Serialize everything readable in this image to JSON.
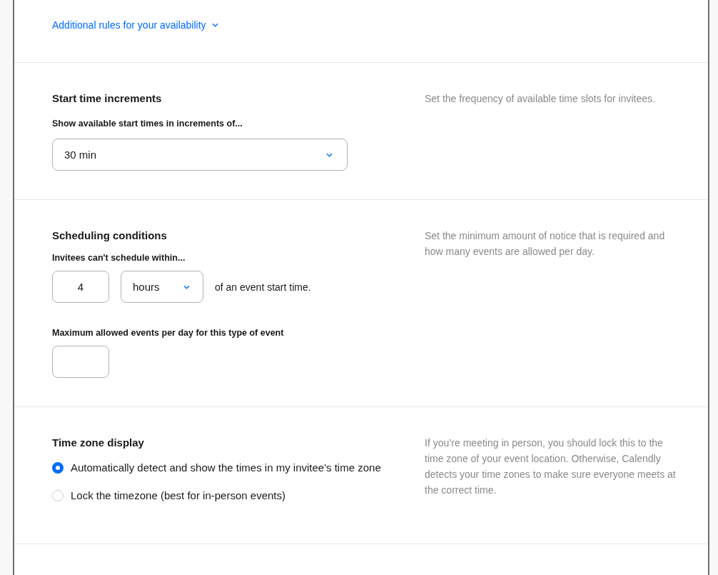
{
  "availability_link": {
    "label": "Additional rules for your availability"
  },
  "sections": [
    {
      "title": "Start time increments",
      "description": "Set the frequency of available time slots for invitees.",
      "items": [
        {
          "kind": "select",
          "label": "Show available start times in increments of...",
          "value": "30 min"
        }
      ]
    },
    {
      "title": "Scheduling conditions",
      "description": "Set the minimum amount of notice that is required and how many events are allowed per day.",
      "items": [
        {
          "kind": "notice",
          "label": "Invitees can't schedule within...",
          "amount": "4",
          "unit": "hours",
          "suffix": "of an event start time."
        },
        {
          "kind": "number",
          "label": "Maximum allowed events per day for this type of event"
        }
      ]
    },
    {
      "title": "Time zone display",
      "description": "If you’re meeting in person, you should lock this to the time zone of your event location. Otherwise, Calendly detects your time zones to make sure everyone meets at the correct time.",
      "items": [
        {
          "kind": "radios",
          "options": [
            {
              "label": "Automatically detect and show the times in my invitee's time zone",
              "selected": true
            },
            {
              "label": "Lock the timezone (best for in-person events)",
              "selected": false
            }
          ]
        }
      ]
    }
  ]
}
